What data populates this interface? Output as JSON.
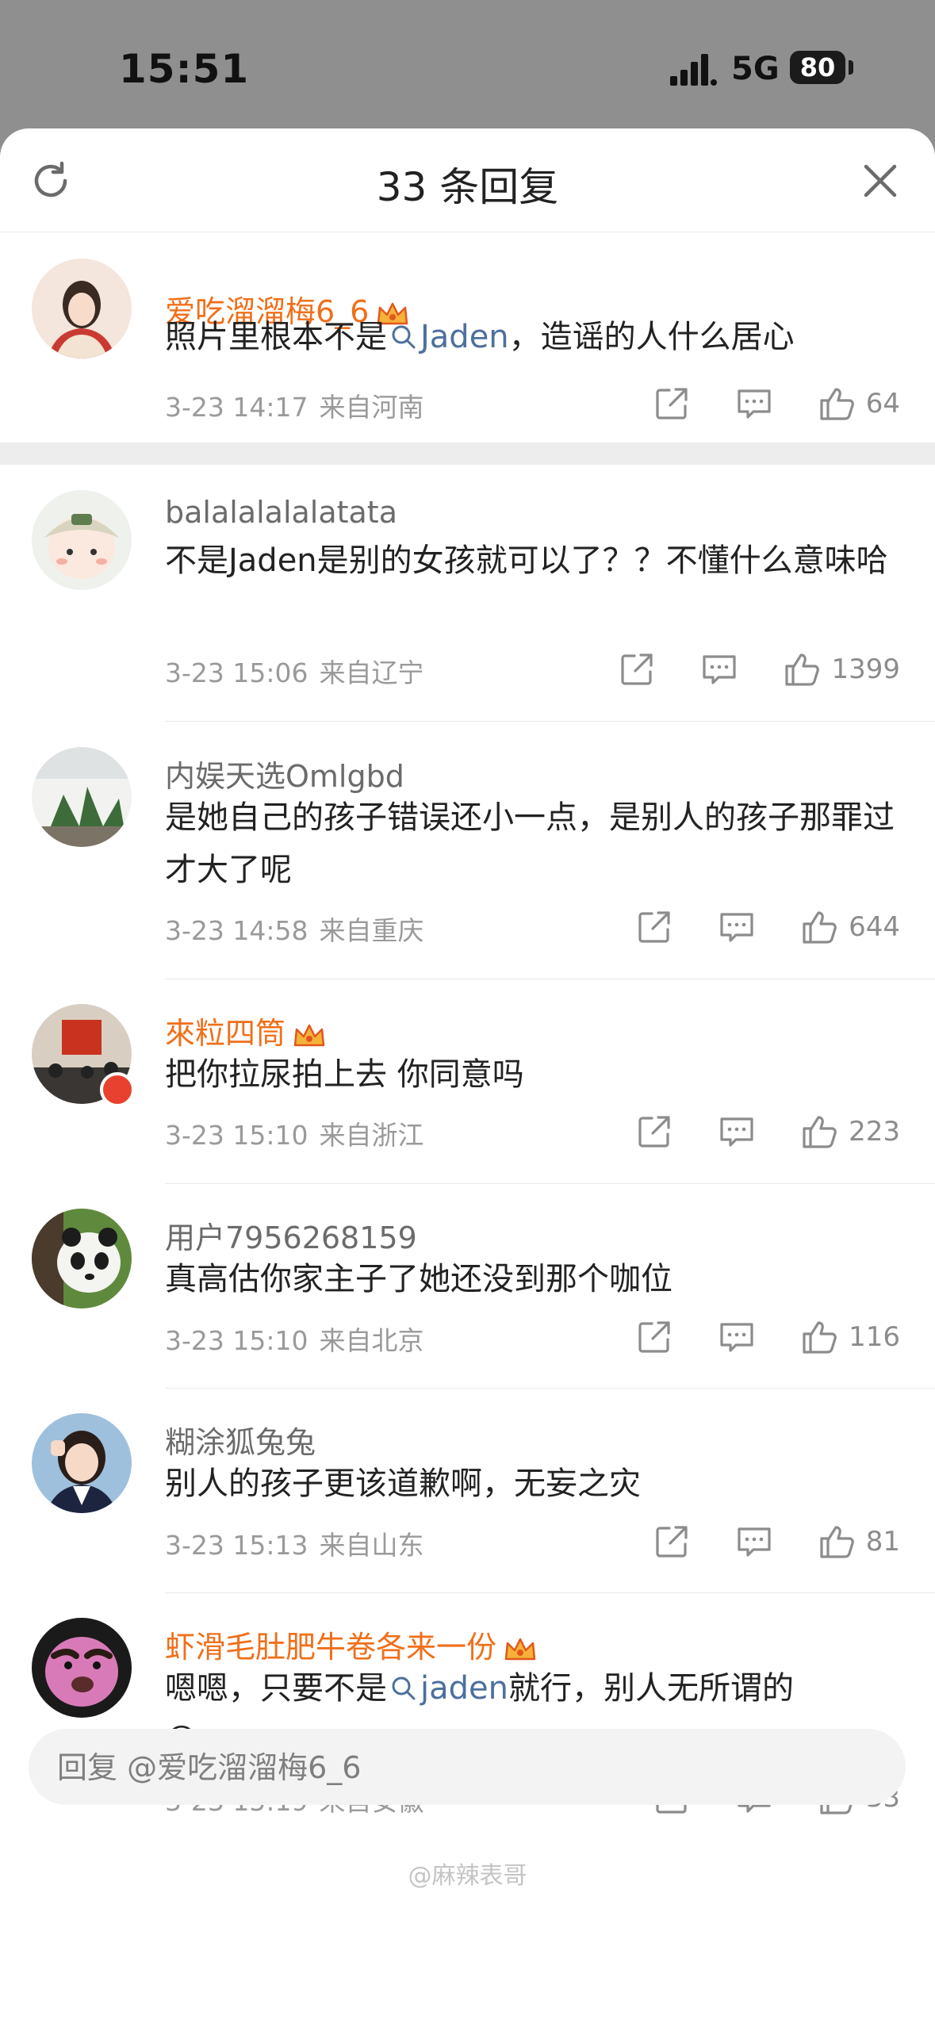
{
  "status_bar": {
    "time": "15:51",
    "network": "5G",
    "battery": "80"
  },
  "sheet": {
    "title": "33 条回复"
  },
  "comments": [
    {
      "user": "爱吃溜溜梅6_6",
      "text_before": "照片里根本不是",
      "link": "Jaden",
      "text_after": "，造谣的人什么居心",
      "time": "3-23 14:17",
      "location": "来自河南",
      "likes": "64"
    },
    {
      "user": "balalalalalatata",
      "text": "不是Jaden是别的女孩就可以了？？不懂什么意味哈",
      "time": "3-23 15:06",
      "location": "来自辽宁",
      "likes": "1399"
    },
    {
      "user": "内娱天选Omlgbd",
      "text": "是她自己的孩子错误还小一点，是别人的孩子那罪过才大了呢",
      "time": "3-23 14:58",
      "location": "来自重庆",
      "likes": "644"
    },
    {
      "user": "來粒四筒",
      "text": "把你拉尿拍上去 你同意吗",
      "time": "3-23 15:10",
      "location": "来自浙江",
      "likes": "223"
    },
    {
      "user": "用户7956268159",
      "text": "真高估你家主子了她还没到那个咖位",
      "time": "3-23 15:10",
      "location": "来自北京",
      "likes": "116"
    },
    {
      "user": "糊涂狐兔兔",
      "text": "别人的孩子更该道歉啊，无妄之灾",
      "time": "3-23 15:13",
      "location": "来自山东",
      "likes": "81"
    },
    {
      "user": "虾滑毛肚肥牛卷各来一份",
      "text_before": "嗯嗯，只要不是",
      "link": "jaden",
      "text_after": "就行，别人无所谓的",
      "emoji": "😅",
      "time": "3-23 15:19",
      "location": "来自安徽",
      "likes": "33"
    }
  ],
  "reply": {
    "placeholder": "回复 @爱吃溜溜梅6_6"
  },
  "watermark": "@麻辣表哥",
  "colors": {
    "vip_name": "#f06f1a",
    "link": "#4c6f9e",
    "meta": "#9a9a9a"
  }
}
